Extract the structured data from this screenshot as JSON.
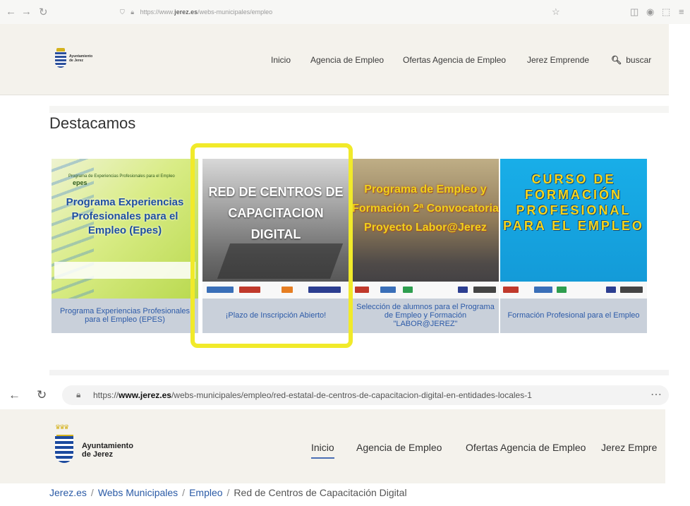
{
  "browser1": {
    "url_prefix": "https://www.",
    "url_domain": "jerez.es",
    "url_path": "/webs-municipales/empleo"
  },
  "site": {
    "logo_text_1": "Ayuntamiento",
    "logo_text_2": "de Jerez",
    "nav": [
      "Inicio",
      "Agencia de Empleo",
      "Ofertas Agencia de Empleo",
      "Jerez Emprende"
    ],
    "search_label": "buscar"
  },
  "destacamos": {
    "heading": "Destacamos",
    "cards": [
      {
        "image_small": "Programa de Experiencias Profesionales para el Empleo",
        "image_tag": "epes",
        "image_title": "Programa Experiencias Profesionales para el Empleo (Epes)",
        "caption": "Programa Experiencias Profesionales para el Empleo (EPES)"
      },
      {
        "image_title": "RED DE CENTROS DE CAPACITACION DIGITAL",
        "caption": "¡Plazo de Inscripción Abierto!"
      },
      {
        "image_title": "Programa de Empleo y Formación 2ª Convocatoria Proyecto Labor@Jerez",
        "caption": "Selección de alumnos para el Programa de Empleo y Formación \"LABOR@JEREZ\""
      },
      {
        "image_title": "CURSO DE FORMACIÓN PROFESIONAL PARA EL EMPLEO",
        "caption": "Formación Profesional para el Empleo"
      }
    ]
  },
  "browser2": {
    "url_prefix": "https://",
    "url_domain": "www.jerez.es",
    "url_path": "/webs-municipales/empleo/red-estatal-de-centros-de-capacitacion-digital-en-entidades-locales-1"
  },
  "site2": {
    "nav": [
      "Inicio",
      "Agencia de Empleo",
      "Ofertas Agencia de Empleo",
      "Jerez Empre"
    ]
  },
  "breadcrumb": [
    "Jerez.es",
    "Webs Municipales",
    "Empleo",
    "Red de Centros de Capacitación Digital"
  ],
  "separator": "/",
  "colors": {
    "highlight": "#f1ea2a",
    "link": "#2a5aa6",
    "card_caption": "#2c5aa8"
  }
}
